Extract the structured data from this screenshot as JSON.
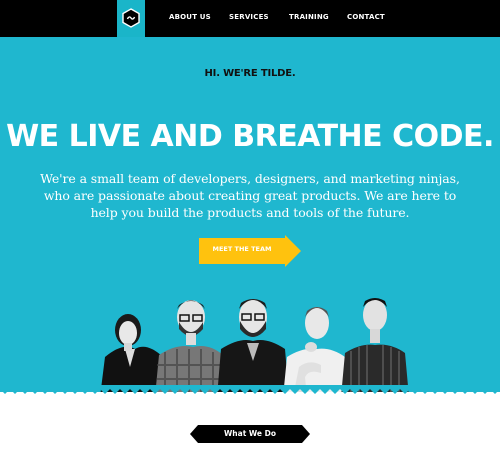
{
  "nav": {
    "items": [
      {
        "label": "ABOUT US"
      },
      {
        "label": "SERVICES"
      },
      {
        "label": "TRAINING"
      },
      {
        "label": "CONTACT"
      }
    ],
    "logo_icon": "hexagon-logo-icon"
  },
  "hero": {
    "tagline": "HI. WE'RE TILDE.",
    "headline": "WE LIVE AND BREATHE CODE.",
    "intro": "We're a small team of developers, designers, and marketing ninjas, who are passionate about creating great products. We are here to help you build the products and tools of the future.",
    "cta_label": "MEET THE TEAM"
  },
  "section": {
    "tab_label": "What We Do"
  },
  "colors": {
    "brand": "#1fb7cf",
    "accent": "#ffc20e",
    "nav_bg": "#000000"
  }
}
